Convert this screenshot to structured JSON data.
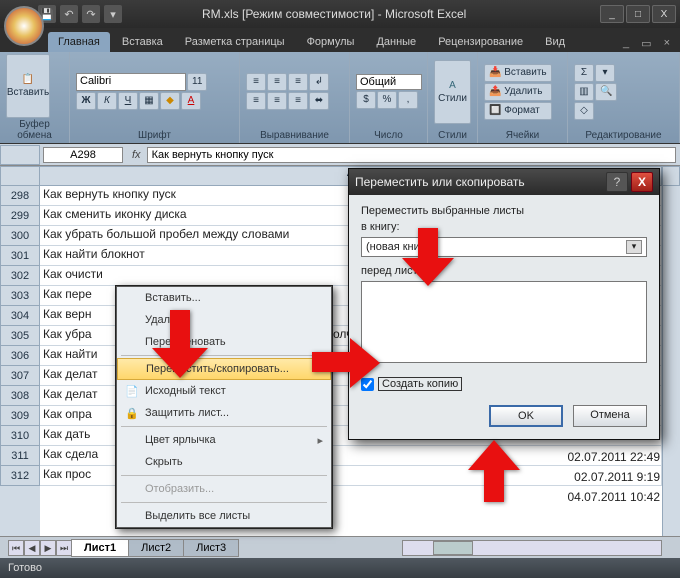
{
  "window": {
    "title": "RM.xls [Режим совместимости] - Microsoft Excel",
    "min": "_",
    "max": "□",
    "close": "X",
    "doc_min": "_",
    "doc_max": "▭",
    "doc_close": "×"
  },
  "ribbon": {
    "tabs": [
      "Главная",
      "Вставка",
      "Разметка страницы",
      "Формулы",
      "Данные",
      "Рецензирование",
      "Вид"
    ],
    "active_tab": 0,
    "groups": {
      "clipboard": "Буфер обмена",
      "font": "Шрифт",
      "alignment": "Выравнивание",
      "number": "Число",
      "styles": "Стили",
      "cells": "Ячейки",
      "editing": "Редактирование"
    },
    "paste": "Вставить",
    "font_name": "Calibri",
    "font_size": "11",
    "number_format": "Общий",
    "styles_btn": "Стили",
    "cells_insert": "Вставить",
    "cells_delete": "Удалить",
    "cells_format": "Формат"
  },
  "formula_bar": {
    "name_box": "A298",
    "formula": "Как вернуть кнопку пуск"
  },
  "columns": [
    "A"
  ],
  "rows": [
    {
      "n": "298",
      "a": "Как вернуть кнопку пуск"
    },
    {
      "n": "299",
      "a": "Как сменить иконку диска"
    },
    {
      "n": "300",
      "a": "Как убрать большой пробел между словами"
    },
    {
      "n": "301",
      "a": "Как найти блокнот"
    },
    {
      "n": "302",
      "a": "Как очисти"
    },
    {
      "n": "303",
      "a": "Как пере"
    },
    {
      "n": "304",
      "a": "Как верн"
    },
    {
      "n": "305",
      "a": "Как убра"
    },
    {
      "n": "306",
      "a": "Как найти"
    },
    {
      "n": "307",
      "a": "Как делат"
    },
    {
      "n": "308",
      "a": "Как делат"
    },
    {
      "n": "309",
      "a": "Как опра"
    },
    {
      "n": "310",
      "a": "Как дать"
    },
    {
      "n": "311",
      "a": "Как сдела"
    },
    {
      "n": "312",
      "a": "Как прос"
    }
  ],
  "context_menu": {
    "items": [
      {
        "label": "Вставить...",
        "icon": ""
      },
      {
        "label": "Удалить",
        "icon": ""
      },
      {
        "label": "Переименовать",
        "icon": ""
      },
      {
        "label": "Переместить/скопировать...",
        "icon": "",
        "hover": true
      },
      {
        "label": "Исходный текст",
        "icon": "📄"
      },
      {
        "label": "Защитить лист...",
        "icon": "🔒"
      },
      {
        "label": "Цвет ярлычка",
        "icon": "",
        "sub": "▸"
      },
      {
        "label": "Скрыть",
        "icon": ""
      },
      {
        "label": "Отобразить...",
        "icon": "",
        "disabled": true
      },
      {
        "label": "Выделить все листы",
        "icon": ""
      }
    ],
    "default_suffix": "олчан"
  },
  "dialog": {
    "title": "Переместить или скопировать",
    "label_move": "Переместить выбранные листы",
    "label_book": "в книгу:",
    "combo_value": "(новая книга)",
    "label_before": "перед листом:",
    "check_label": "Создать копию",
    "ok": "OK",
    "cancel": "Отмена"
  },
  "sheet_tabs": {
    "tabs": [
      "Лист1",
      "Лист2",
      "Лист3"
    ],
    "active": 0
  },
  "status": "Готово",
  "visible_timestamps": [
    "02.07.2011 22:49",
    "02.07.2011 9:19",
    "04.07.2011 10:42"
  ]
}
